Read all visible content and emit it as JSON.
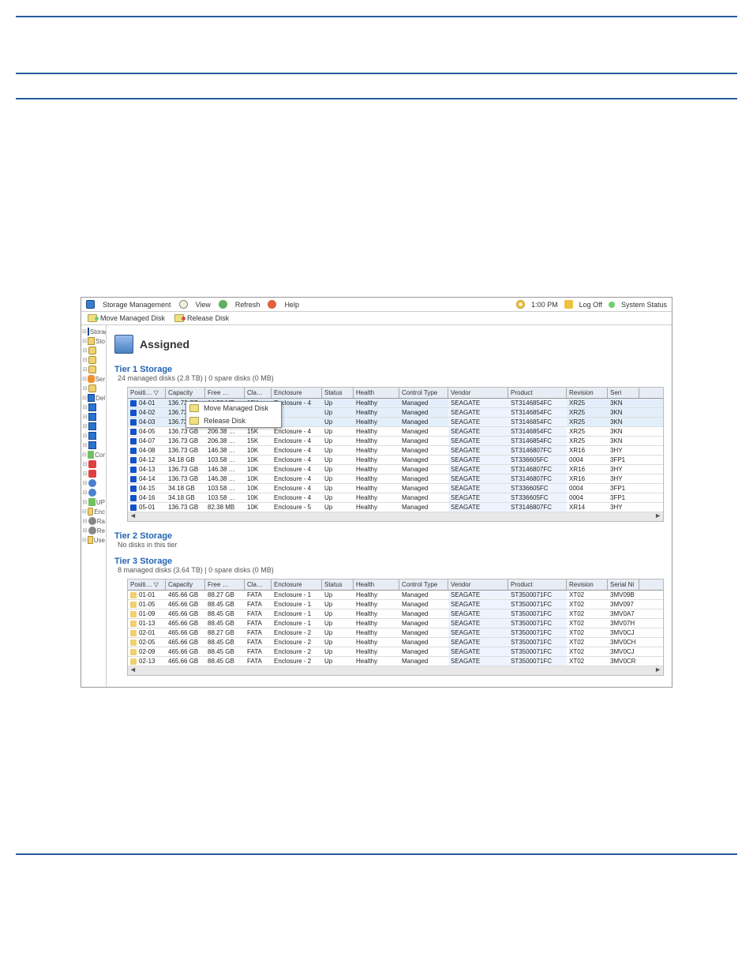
{
  "titlebar": {
    "storage_mgmt": "Storage Management",
    "view": "View",
    "refresh": "Refresh",
    "help": "Help",
    "time": "1:00 PM",
    "logoff": "Log Off",
    "system_status": "System Status"
  },
  "actionbar": {
    "move": "Move Managed Disk",
    "release": "Release Disk"
  },
  "tree": [
    {
      "glyph": "box",
      "text": "Storage"
    },
    {
      "glyph": "folder",
      "text": "Sto"
    },
    {
      "glyph": "cyl",
      "text": ""
    },
    {
      "glyph": "cyl",
      "text": ""
    },
    {
      "glyph": "cyl",
      "text": ""
    },
    {
      "glyph": "orange",
      "text": "Ser"
    },
    {
      "glyph": "cyl",
      "text": ""
    },
    {
      "glyph": "box",
      "text": "Del"
    },
    {
      "glyph": "box",
      "text": ""
    },
    {
      "glyph": "",
      "text": ""
    },
    {
      "glyph": "",
      "text": ""
    },
    {
      "glyph": "",
      "text": ""
    },
    {
      "glyph": "",
      "text": ""
    },
    {
      "glyph": "green",
      "text": "Cor"
    },
    {
      "glyph": "red",
      "text": ""
    },
    {
      "glyph": "red",
      "text": ""
    },
    {
      "glyph": "blue",
      "text": ""
    },
    {
      "glyph": "blue",
      "text": ""
    },
    {
      "glyph": "green",
      "text": "UP"
    },
    {
      "glyph": "cyl",
      "text": "Enc"
    },
    {
      "glyph": "gear",
      "text": "Ra"
    },
    {
      "glyph": "gear",
      "text": "Re"
    },
    {
      "glyph": "folder",
      "text": "Use"
    }
  ],
  "panel_title": "Assigned",
  "tiers": {
    "t1": {
      "header": "Tier 1 Storage",
      "summary": "24 managed disks (2.8 TB) | 0 spare disks (0 MB)"
    },
    "t2": {
      "header": "Tier 2 Storage",
      "summary": "No disks in this tier"
    },
    "t3": {
      "header": "Tier 3 Storage",
      "summary": "8 managed disks (3.64 TB) | 0 spare disks (0 MB)"
    }
  },
  "columns": {
    "pos": "Positi…",
    "cap": "Capacity",
    "free": "Free …",
    "cla": "Cla…",
    "enc": "Enclosure",
    "stat": "Status",
    "health": "Health",
    "ctrl": "Control Type",
    "vend": "Vendor",
    "prod": "Product",
    "rev": "Revision",
    "ser1": "Seri",
    "ser3": "Serial Ni"
  },
  "ctx": {
    "move": "Move Managed Disk",
    "release": "Release Disk"
  },
  "kw": {
    "up": "Up",
    "healthy": "Healthy",
    "managed": "Managed",
    "seagate": "SEAGATE"
  },
  "t1rows": [
    {
      "p": "04-01",
      "cap": "136.73 GB",
      "free": "14.38 MB",
      "cla": "15K",
      "enc": "Enclosure - 4",
      "prod": "ST3146854FC",
      "rev": "XR25",
      "ser": "3KN"
    },
    {
      "p": "04-02",
      "cap": "136.73 …",
      "free": "",
      "cla": "",
      "enc": "- 4",
      "prod": "ST3146854FC",
      "rev": "XR25",
      "ser": "3KN"
    },
    {
      "p": "04-03",
      "cap": "136.73 …",
      "free": "",
      "cla": "",
      "enc": "- 4",
      "prod": "ST3146854FC",
      "rev": "XR25",
      "ser": "3KN"
    },
    {
      "p": "04-05",
      "cap": "136.73 GB",
      "free": "206.38 …",
      "cla": "15K",
      "enc": "Enclosure - 4",
      "prod": "ST3146854FC",
      "rev": "XR25",
      "ser": "3KN"
    },
    {
      "p": "04-07",
      "cap": "136.73 GB",
      "free": "206.38 …",
      "cla": "15K",
      "enc": "Enclosure - 4",
      "prod": "ST3146854FC",
      "rev": "XR25",
      "ser": "3KN"
    },
    {
      "p": "04-08",
      "cap": "136.73 GB",
      "free": "146.38 …",
      "cla": "10K",
      "enc": "Enclosure - 4",
      "prod": "ST3146807FC",
      "rev": "XR16",
      "ser": "3HY"
    },
    {
      "p": "04-12",
      "cap": "34.18 GB",
      "free": "103.58 …",
      "cla": "10K",
      "enc": "Enclosure - 4",
      "prod": "ST336605FC",
      "rev": "0004",
      "ser": "3FP1"
    },
    {
      "p": "04-13",
      "cap": "136.73 GB",
      "free": "146.38 …",
      "cla": "10K",
      "enc": "Enclosure - 4",
      "prod": "ST3146807FC",
      "rev": "XR16",
      "ser": "3HY"
    },
    {
      "p": "04-14",
      "cap": "136.73 GB",
      "free": "146.38 …",
      "cla": "10K",
      "enc": "Enclosure - 4",
      "prod": "ST3146807FC",
      "rev": "XR16",
      "ser": "3HY"
    },
    {
      "p": "04-15",
      "cap": "34.18 GB",
      "free": "103.58 …",
      "cla": "10K",
      "enc": "Enclosure - 4",
      "prod": "ST336605FC",
      "rev": "0004",
      "ser": "3FP1"
    },
    {
      "p": "04-16",
      "cap": "34.18 GB",
      "free": "103.58 …",
      "cla": "10K",
      "enc": "Enclosure - 4",
      "prod": "ST336605FC",
      "rev": "0004",
      "ser": "3FP1"
    },
    {
      "p": "05-01",
      "cap": "136.73 GB",
      "free": "82.38 MB",
      "cla": "10K",
      "enc": "Enclosure - 5",
      "prod": "ST3146807FC",
      "rev": "XR14",
      "ser": "3HY"
    }
  ],
  "t3rows": [
    {
      "p": "01-01",
      "cap": "465.66 GB",
      "free": "88.27 GB",
      "cla": "FATA",
      "enc": "Enclosure - 1",
      "prod": "ST3500071FC",
      "rev": "XT02",
      "ser": "3MV09B"
    },
    {
      "p": "01-05",
      "cap": "465.66 GB",
      "free": "88.45 GB",
      "cla": "FATA",
      "enc": "Enclosure - 1",
      "prod": "ST3500071FC",
      "rev": "XT02",
      "ser": "3MV097"
    },
    {
      "p": "01-09",
      "cap": "465.66 GB",
      "free": "88.45 GB",
      "cla": "FATA",
      "enc": "Enclosure - 1",
      "prod": "ST3500071FC",
      "rev": "XT02",
      "ser": "3MV0A7"
    },
    {
      "p": "01-13",
      "cap": "465.66 GB",
      "free": "88.45 GB",
      "cla": "FATA",
      "enc": "Enclosure - 1",
      "prod": "ST3500071FC",
      "rev": "XT02",
      "ser": "3MV07H"
    },
    {
      "p": "02-01",
      "cap": "465.66 GB",
      "free": "88.27 GB",
      "cla": "FATA",
      "enc": "Enclosure - 2",
      "prod": "ST3500071FC",
      "rev": "XT02",
      "ser": "3MV0CJ"
    },
    {
      "p": "02-05",
      "cap": "465.66 GB",
      "free": "88.45 GB",
      "cla": "FATA",
      "enc": "Enclosure - 2",
      "prod": "ST3500071FC",
      "rev": "XT02",
      "ser": "3MV0CH"
    },
    {
      "p": "02-09",
      "cap": "465.66 GB",
      "free": "88.45 GB",
      "cla": "FATA",
      "enc": "Enclosure - 2",
      "prod": "ST3500071FC",
      "rev": "XT02",
      "ser": "3MV0CJ"
    },
    {
      "p": "02-13",
      "cap": "465.66 GB",
      "free": "88.45 GB",
      "cla": "FATA",
      "enc": "Enclosure - 2",
      "prod": "ST3500071FC",
      "rev": "XT02",
      "ser": "3MV0CR"
    }
  ]
}
